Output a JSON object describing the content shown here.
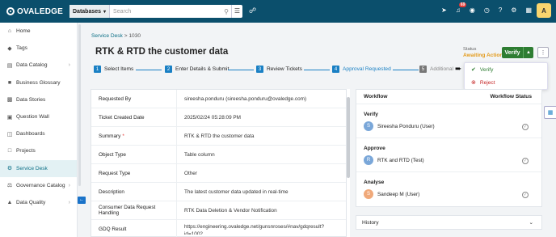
{
  "topbar": {
    "logo_text": "OVALEDGE",
    "search_scope": "Databases",
    "search_placeholder": "Search",
    "notification_count": "69",
    "avatar_initial": "A"
  },
  "sidebar": {
    "items": [
      {
        "label": "Home",
        "icon": "home-icon"
      },
      {
        "label": "Tags",
        "icon": "tag-icon"
      },
      {
        "label": "Data Catalog",
        "icon": "catalog-icon"
      },
      {
        "label": "Business Glossary",
        "icon": "glossary-icon"
      },
      {
        "label": "Data Stories",
        "icon": "stories-icon"
      },
      {
        "label": "Question Wall",
        "icon": "question-icon"
      },
      {
        "label": "Dashboards",
        "icon": "dashboard-icon"
      },
      {
        "label": "Projects",
        "icon": "projects-icon"
      },
      {
        "label": "Service Desk",
        "icon": "service-desk-icon"
      },
      {
        "label": "Governance Catalog",
        "icon": "governance-icon"
      },
      {
        "label": "Data Quality",
        "icon": "quality-icon"
      }
    ]
  },
  "breadcrumb": {
    "root": "Service Desk",
    "separator": ">",
    "current": "1030"
  },
  "page": {
    "title": "RTK & RTD the customer data",
    "status_label": "Status",
    "status_value": "Awaiting Action",
    "primary_action": "Verify"
  },
  "steps": [
    {
      "num": "1",
      "label": "Select Items"
    },
    {
      "num": "2",
      "label": "Enter Details & Submit"
    },
    {
      "num": "3",
      "label": "Review Tickets"
    },
    {
      "num": "4",
      "label": "Approval Requested"
    },
    {
      "num": "5",
      "label": "Additional"
    }
  ],
  "dropdown": {
    "verify": "Verify",
    "reject": "Reject"
  },
  "details": {
    "requested_by_label": "Requested By",
    "requested_by": "sireesha.ponduru (sireesha.ponduru@ovaledge.com)",
    "created_label": "Ticket Created Date",
    "created": "2025/02/24 05:28:09 PM",
    "summary_label": "Summary",
    "summary": "RTK & RTD the customer data",
    "object_type_label": "Object Type",
    "object_type": "Table column",
    "request_type_label": "Request Type",
    "request_type": "Other",
    "description_label": "Description",
    "description": "The latest customer data updated in real-time",
    "handling_label": "Consumer Data Request Handling",
    "handling": "RTK Data Deletion & Vendor Notification",
    "gdq_label": "GDQ Result",
    "gdq": "https://engineering.ovaledge.net/gunsnroses/#nav/gdqresult?",
    "gdq_cont": "id=1002"
  },
  "workflow": {
    "header": "Workflow",
    "status_header": "Workflow Status",
    "sections": [
      {
        "label": "Verify",
        "initial": "S",
        "user": "Sireesha Ponduru (User)"
      },
      {
        "label": "Approve",
        "initial": "R",
        "user": "RTK and RTD (Test)"
      },
      {
        "label": "Analyse",
        "initial": "S",
        "user": "Sandeep M (User)"
      }
    ]
  },
  "history": {
    "label": "History"
  }
}
